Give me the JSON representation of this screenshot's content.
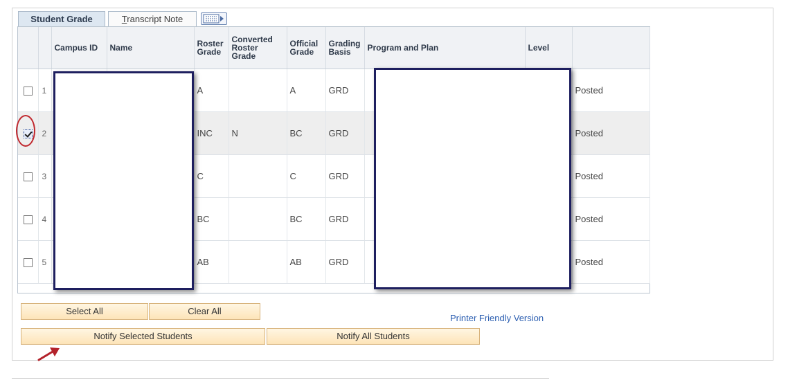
{
  "tabs": [
    {
      "label": "Student Grade",
      "active": true
    },
    {
      "label_prefix": "",
      "label_underline": "T",
      "label_rest": "ranscript Note",
      "active": false
    }
  ],
  "columns": [
    "",
    "",
    "Campus ID",
    "Name",
    "Roster Grade",
    "Converted Roster Grade",
    "Official Grade",
    "Grading Basis",
    "Program and Plan",
    "Level",
    ""
  ],
  "rows": [
    {
      "num": "1",
      "checked": false,
      "roster": "A",
      "converted": "",
      "official": "A",
      "basis": "GRD",
      "status": "Posted"
    },
    {
      "num": "2",
      "checked": true,
      "roster": "INC",
      "converted": "N",
      "official": "BC",
      "basis": "GRD",
      "status": "Posted"
    },
    {
      "num": "3",
      "checked": false,
      "roster": "C",
      "converted": "",
      "official": "C",
      "basis": "GRD",
      "status": "Posted"
    },
    {
      "num": "4",
      "checked": false,
      "roster": "BC",
      "converted": "",
      "official": "BC",
      "basis": "GRD",
      "status": "Posted"
    },
    {
      "num": "5",
      "checked": false,
      "roster": "AB",
      "converted": "",
      "official": "AB",
      "basis": "GRD",
      "status": "Posted"
    }
  ],
  "buttons": {
    "select_all": "Select All",
    "clear_all": "Clear All",
    "notify_selected": "Notify Selected Students",
    "notify_all": "Notify All Students"
  },
  "links": {
    "printer_friendly": "Printer Friendly Version"
  },
  "icons": {
    "grid_view": "grid-view-icon",
    "checkbox_checked": "check-icon",
    "annotation_arrow": "arrow-icon"
  },
  "colors": {
    "accent_link": "#2a5db0",
    "button_border": "#d7b27a",
    "callout": "#c0262c",
    "redaction_border": "#1e1f5f"
  }
}
